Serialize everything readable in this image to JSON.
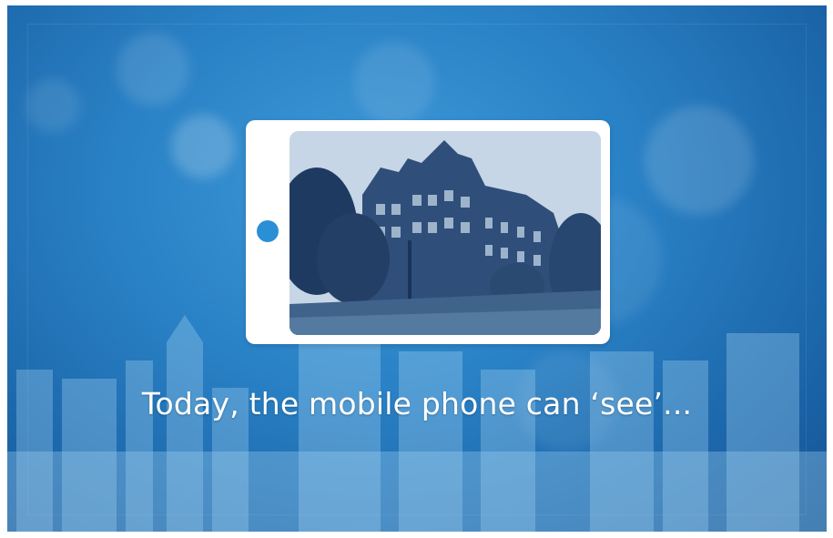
{
  "caption": "Today, the mobile phone can ‘see’...",
  "colors": {
    "background": "#2a82c6",
    "phone_body": "#ffffff",
    "phone_button": "#2b8fd6",
    "caption_text": "#ffffff"
  },
  "icons": {
    "phone_button": "circle-button-icon"
  }
}
